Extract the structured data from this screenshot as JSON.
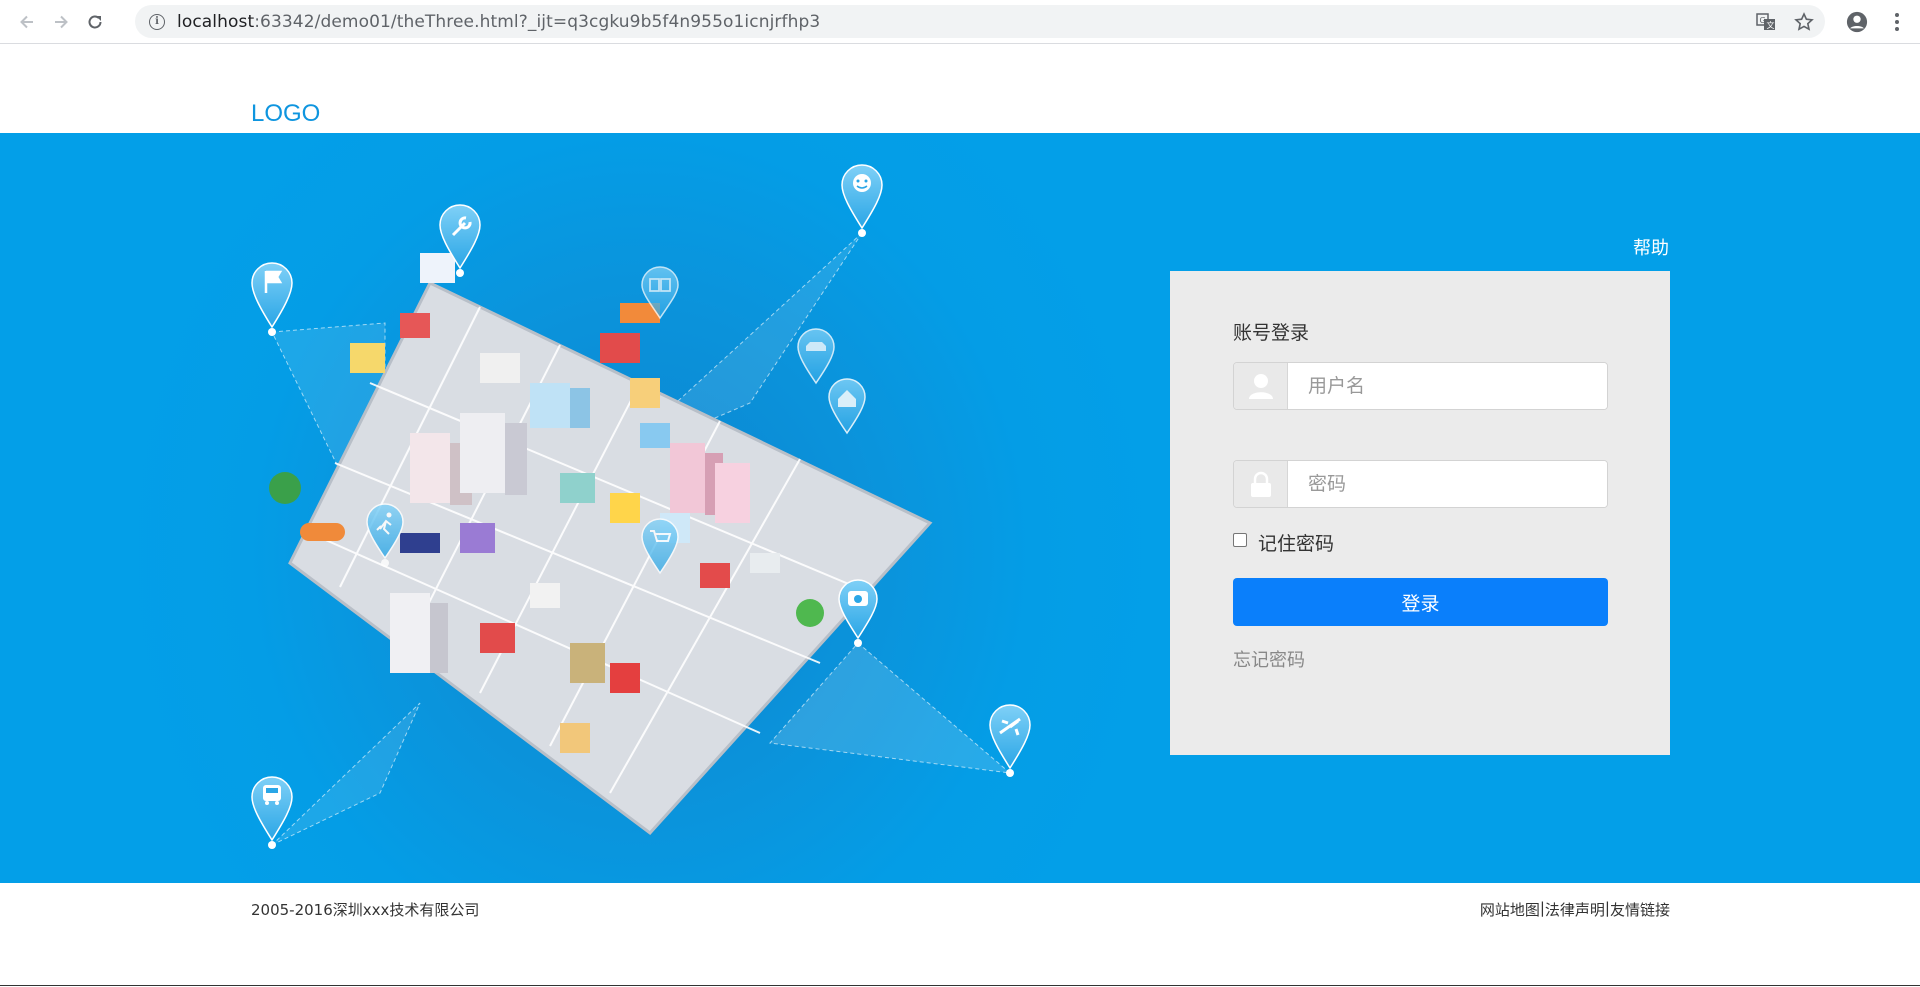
{
  "browser": {
    "url_host": "localhost",
    "url_rest": ":63342/demo01/theThree.html?_ijt=q3cgku9b5f4n955o1icnjrfhp3",
    "icons": [
      "back-icon",
      "forward-icon",
      "reload-icon",
      "info-icon",
      "translate-icon",
      "star-icon",
      "account-icon",
      "menu-icon"
    ]
  },
  "header": {
    "logo": "LOGO"
  },
  "banner": {
    "help": "帮助",
    "pins": [
      "flag-icon",
      "wrench-icon",
      "smiley-icon",
      "book-icon",
      "car-icon",
      "home-icon",
      "run-icon",
      "cart-icon",
      "camera-icon",
      "plane-icon",
      "bus-icon"
    ]
  },
  "login": {
    "title": "账号登录",
    "username_placeholder": "用户名",
    "password_placeholder": "密码",
    "remember_label": "记住密码",
    "submit_label": "登录",
    "forgot_label": "忘记密码"
  },
  "footer": {
    "copyright": "2005-2016深圳xxx技术有限公司",
    "links": [
      "网站地图",
      "法律声明",
      "友情链接"
    ],
    "separator": "|"
  },
  "colors": {
    "banner_blue": "#039fe8",
    "button_blue": "#0a7ffb",
    "logo_blue": "#0e95df",
    "panel_gray": "#ebebeb"
  }
}
